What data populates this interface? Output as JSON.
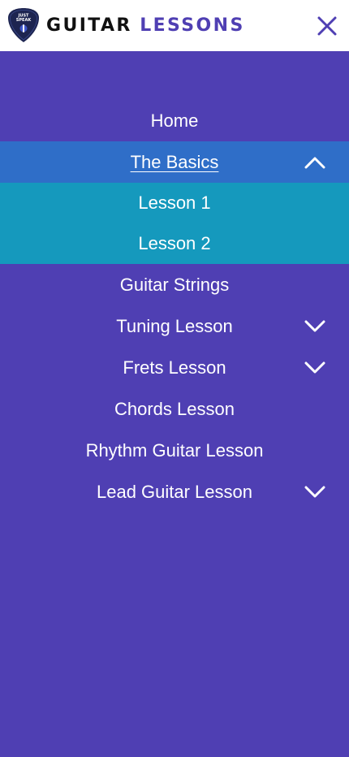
{
  "header": {
    "logo_text_line1": "JUST",
    "logo_text_line2": "SPEAK",
    "title_word_1": "GUITAR",
    "title_word_2": "LESSONS",
    "close_icon": "close-icon",
    "brand_color": "#4f3fb3"
  },
  "menu": {
    "items": [
      {
        "label": "Home"
      },
      {
        "label": "The Basics",
        "expanded": true,
        "icon": "chevron-up-icon"
      },
      {
        "label": "Lesson 1"
      },
      {
        "label": "Lesson 2"
      },
      {
        "label": "Guitar Strings"
      },
      {
        "label": "Tuning Lesson",
        "icon": "chevron-down-icon"
      },
      {
        "label": "Frets Lesson",
        "icon": "chevron-down-icon"
      },
      {
        "label": "Chords Lesson"
      },
      {
        "label": "Rhythm Guitar Lesson"
      },
      {
        "label": "Lead Guitar Lesson",
        "icon": "chevron-down-icon"
      }
    ]
  },
  "colors": {
    "background": "#4f3fb3",
    "active_item": "#2f6ec8",
    "submenu_item": "#1599bd",
    "text": "#ffffff"
  }
}
